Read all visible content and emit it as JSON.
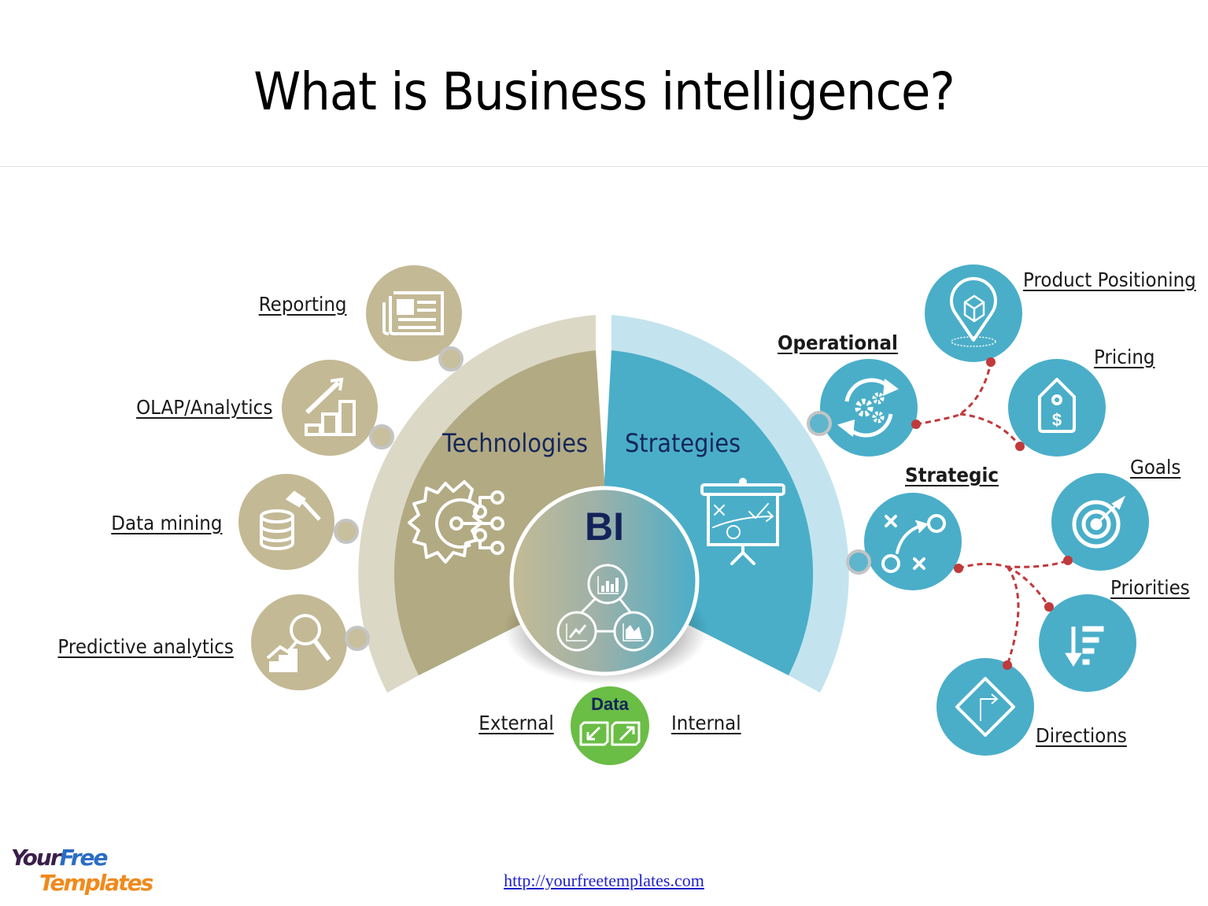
{
  "slide": {
    "title": "What is Business intelligence?",
    "footer_link": "http://yourfreetemplates.com",
    "logo": {
      "line1_a": "Your",
      "line1_b": "Free",
      "line2": "Templates"
    }
  },
  "colors": {
    "technologies_outer": "#dcd8c6",
    "technologies_inner": "#b2aa83",
    "technologies_node": "#c3b995",
    "strategies_outer": "#c3e4ee",
    "strategies_inner": "#4aaec9",
    "strategies_node": "#4aaec9",
    "connector_ring": "#c0c0c0",
    "data_node": "#6abd45",
    "dashed_link": "#c0393b",
    "title_text": "#14265a"
  },
  "center": {
    "bi_label": "BI",
    "bi_icon": "analytics-cycle-icon",
    "data_label": "Data",
    "data_icon": "import-export-icon",
    "data_sources": {
      "left": "External",
      "right": "Internal"
    }
  },
  "technologies": {
    "title": "Technologies",
    "icon": "gear-circuit-icon",
    "items": [
      {
        "label": "Reporting",
        "icon": "newspaper-icon"
      },
      {
        "label": "OLAP/Analytics",
        "icon": "growth-chart-icon"
      },
      {
        "label": "Data mining",
        "icon": "database-hammer-icon"
      },
      {
        "label": "Predictive analytics",
        "icon": "magnifier-chart-icon"
      }
    ]
  },
  "strategies": {
    "title": "Strategies",
    "icon": "presentation-board-icon",
    "groups": [
      {
        "label": "Operational",
        "icon": "gears-cycle-icon",
        "children": [
          {
            "label": "Product Positioning",
            "icon": "location-box-icon"
          },
          {
            "label": "Pricing",
            "icon": "price-tag-icon"
          }
        ]
      },
      {
        "label": "Strategic",
        "icon": "game-plan-icon",
        "children": [
          {
            "label": "Goals",
            "icon": "target-icon"
          },
          {
            "label": "Priorities",
            "icon": "sort-priority-icon"
          },
          {
            "label": "Directions",
            "icon": "direction-sign-icon"
          }
        ]
      }
    ]
  }
}
